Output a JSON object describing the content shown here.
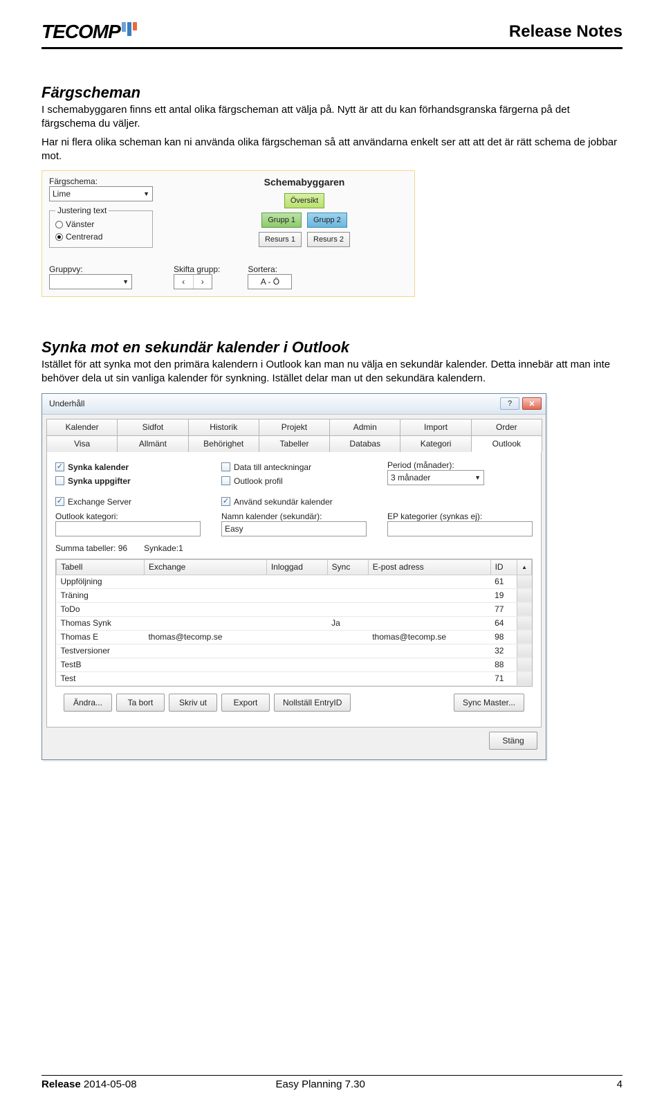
{
  "header": {
    "title": "Release Notes",
    "logo_text": "TECOMP"
  },
  "section1": {
    "title": "Färgscheman",
    "p1": "I schemabyggaren finns ett antal olika färgscheman att välja på. Nytt är att du kan förhandsgranska färgerna på det färgschema du väljer.",
    "p2": "Har ni flera olika scheman kan ni använda olika färgscheman så att användarna enkelt ser att att det är rätt schema de jobbar mot."
  },
  "panel1": {
    "colorscheme_label": "Färgschema:",
    "colorscheme_value": "Lime",
    "justify_legend": "Justering text",
    "justify_left": "Vänster",
    "justify_center": "Centrerad",
    "title": "Schemabyggaren",
    "btn_overview": "Översikt",
    "btn_group1": "Grupp  1",
    "btn_group2": "Grupp  2",
    "btn_res1": "Resurs 1",
    "btn_res2": "Resurs 2",
    "groupview_label": "Gruppvy:",
    "shift_label": "Skifta grupp:",
    "sort_label": "Sortera:",
    "sort_value": "A - Ö"
  },
  "section2": {
    "title": "Synka mot en sekundär kalender i Outlook",
    "p1": "Istället för att synka mot den primära kalendern i Outlook kan man nu välja en sekundär kalender. Detta innebär att man inte behöver dela ut sin vanliga kalender för synkning. Istället delar man ut den sekundära kalendern."
  },
  "dialog": {
    "title": "Underhåll",
    "tabs_row1": [
      "Kalender",
      "Sidfot",
      "Historik",
      "Projekt",
      "Admin",
      "Import",
      "Order"
    ],
    "tabs_row2": [
      "Visa",
      "Allmänt",
      "Behörighet",
      "Tabeller",
      "Databas",
      "Kategori",
      "Outlook"
    ],
    "active_tab": "Outlook",
    "chk_sync_cal": "Synka kalender",
    "chk_sync_cal_checked": true,
    "chk_sync_tasks": "Synka uppgifter",
    "chk_sync_tasks_checked": false,
    "chk_data_notes": "Data till anteckningar",
    "chk_data_notes_checked": false,
    "chk_outlook_profile": "Outlook profil",
    "chk_outlook_profile_checked": false,
    "period_label": "Period (månader):",
    "period_value": "3 månader",
    "chk_exchange": "Exchange Server",
    "chk_exchange_checked": true,
    "chk_secondary": "Använd sekundär kalender",
    "chk_secondary_checked": true,
    "outlook_cat_label": "Outlook kategori:",
    "outlook_cat_value": "",
    "sec_name_label": "Namn kalender (sekundär):",
    "sec_name_value": "Easy",
    "ep_cat_label": "EP kategorier (synkas ej):",
    "ep_cat_value": "",
    "sum_label": "Summa tabeller: 96",
    "synced_label": "Synkade:1",
    "columns": [
      "Tabell",
      "Exchange",
      "Inloggad",
      "Sync",
      "E-post adress",
      "ID"
    ],
    "rows": [
      {
        "tabell": "Uppföljning",
        "exchange": "",
        "inloggad": "",
        "sync": "",
        "epost": "",
        "id": "61"
      },
      {
        "tabell": "Träning",
        "exchange": "",
        "inloggad": "",
        "sync": "",
        "epost": "",
        "id": "19"
      },
      {
        "tabell": "ToDo",
        "exchange": "",
        "inloggad": "",
        "sync": "",
        "epost": "",
        "id": "77"
      },
      {
        "tabell": "Thomas Synk",
        "exchange": "",
        "inloggad": "",
        "sync": "Ja",
        "epost": "",
        "id": "64"
      },
      {
        "tabell": "Thomas E",
        "exchange": "thomas@tecomp.se",
        "inloggad": "",
        "sync": "",
        "epost": "thomas@tecomp.se",
        "id": "98"
      },
      {
        "tabell": "Testversioner",
        "exchange": "",
        "inloggad": "",
        "sync": "",
        "epost": "",
        "id": "32"
      },
      {
        "tabell": "TestB",
        "exchange": "",
        "inloggad": "",
        "sync": "",
        "epost": "",
        "id": "88"
      },
      {
        "tabell": "Test",
        "exchange": "",
        "inloggad": "",
        "sync": "",
        "epost": "",
        "id": "71"
      }
    ],
    "buttons": [
      "Ändra...",
      "Ta bort",
      "Skriv ut",
      "Export",
      "Nollställ EntryID"
    ],
    "sync_master_btn": "Sync Master...",
    "close_btn": "Stäng"
  },
  "footer": {
    "release_label": "Release",
    "release_date": "2014-05-08",
    "product": "Easy Planning 7.30",
    "page": "4"
  }
}
